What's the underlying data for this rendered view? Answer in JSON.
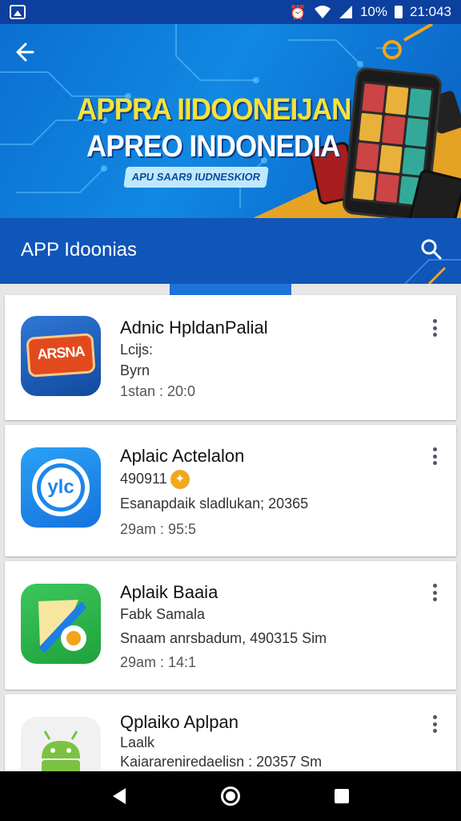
{
  "status_bar": {
    "battery_text": "10%",
    "time": "21:043",
    "icons": [
      "app-notification-icon",
      "alarm-icon",
      "wifi-icon",
      "signal-icon",
      "battery-icon"
    ]
  },
  "banner": {
    "title_line1": "APPRA IIDOONEIJAN",
    "title_line2": "APREO INDONEDIA",
    "tagline": "APU SAAR9 IUDNESKIOR"
  },
  "app_bar": {
    "title": "APP Idoonias"
  },
  "apps": [
    {
      "name": "Adnic HpldanPalial",
      "line1": "Lcijs:",
      "line2": "Byrn",
      "line3": "1stan : 20:0",
      "icon": "basketball-badge-icon",
      "icon_text": "ARSNA"
    },
    {
      "name": "Aplaic Actelalon",
      "line1": "490911",
      "line2": "Esanapdaik sladlukan; 20365",
      "line3": "29am : 95:5",
      "icon": "ylc-circle-icon",
      "icon_text": "ylc"
    },
    {
      "name": "Aplaik Baaia",
      "line1": "Fabk Samala",
      "line2": "Snaam anrsbadum, 490315 Sim",
      "line3": "29am : 14:1",
      "icon": "folded-map-icon"
    },
    {
      "name": "Qplaiko Aplpan",
      "line1": "Laalk",
      "line2": "Kaiarareniredaelisn : 20357 Sm",
      "icon": "android-icon"
    }
  ],
  "colors": {
    "status_bar": "#0d3f9e",
    "app_bar": "#1055b8",
    "tab_indicator": "#1c73d8",
    "rating_badge": "#f0a91b"
  }
}
